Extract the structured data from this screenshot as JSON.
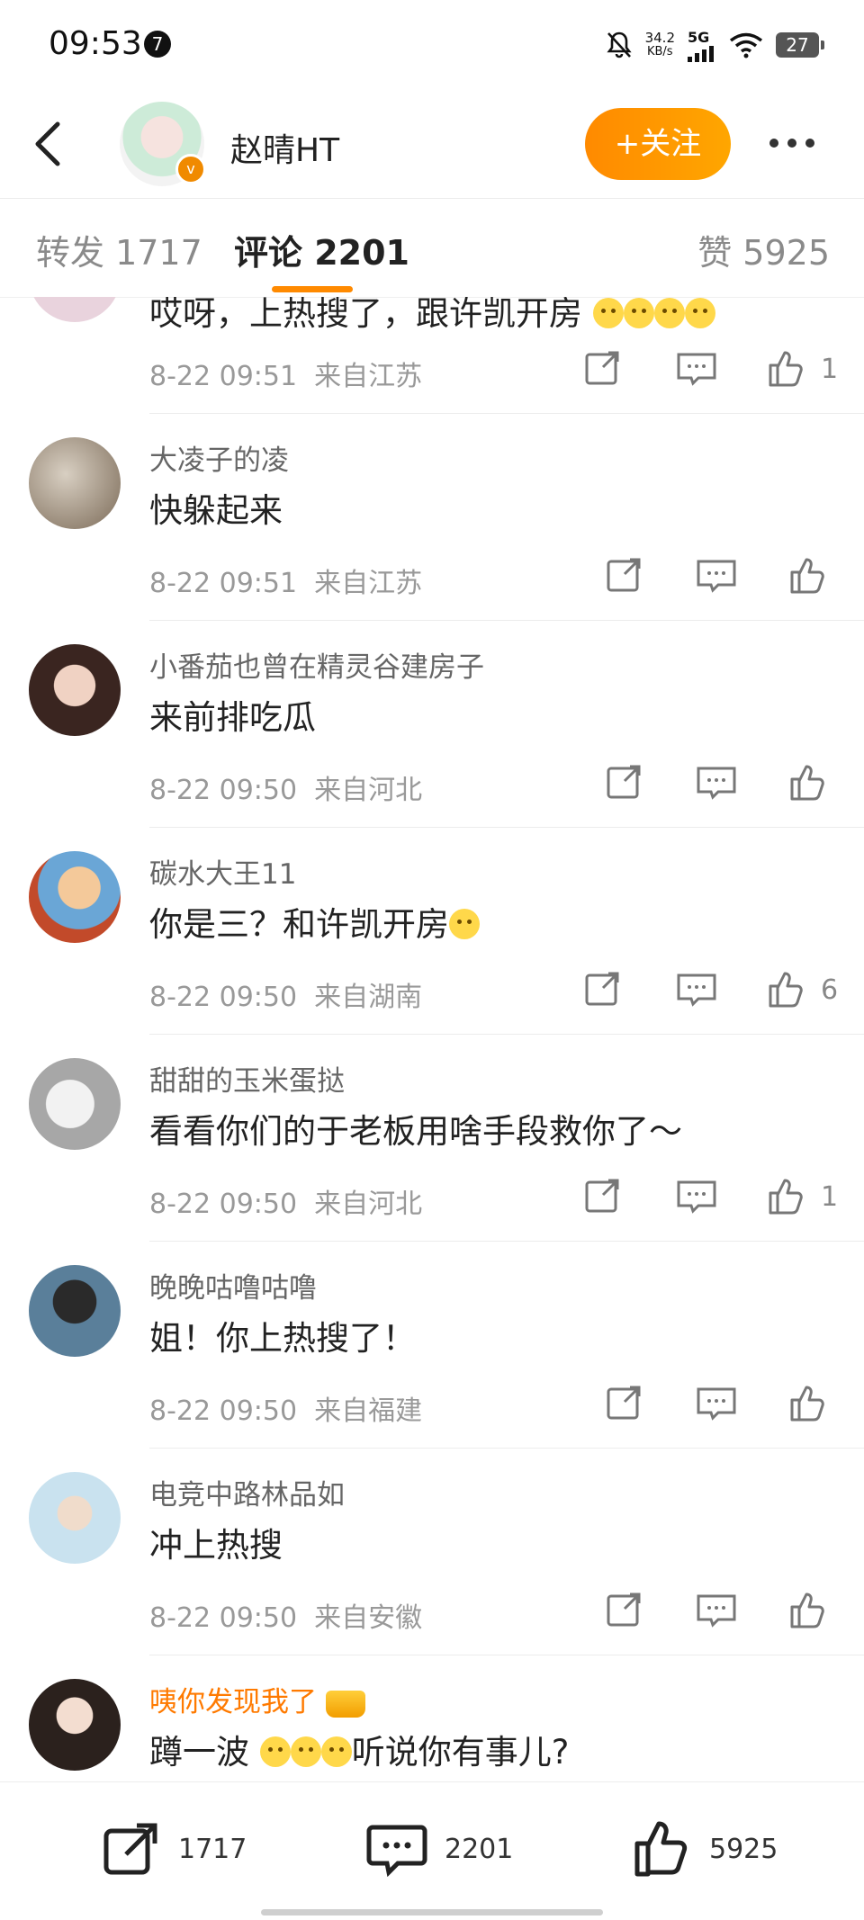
{
  "status_bar": {
    "time": "09:53",
    "notification_count": "7",
    "net_speed_value": "34.2",
    "net_speed_unit": "KB/s",
    "signal_label": "5G",
    "battery": "27"
  },
  "header": {
    "name": "赵晴HT",
    "follow_label": "+关注"
  },
  "tabs": {
    "repost": "转发 1717",
    "comments": "评论 2201",
    "likes": "赞 5925"
  },
  "comments": [
    {
      "name": "",
      "text": "哎呀，上热搜了，跟许凯开房",
      "time": "8-22 09:51",
      "location": "来自江苏",
      "likes": "1"
    },
    {
      "name": "大凌子的凌",
      "text": "快躲起来",
      "time": "8-22 09:51",
      "location": "来自江苏",
      "likes": ""
    },
    {
      "name": "小番茄也曾在精灵谷建房子",
      "text": "来前排吃瓜",
      "time": "8-22 09:50",
      "location": "来自河北",
      "likes": ""
    },
    {
      "name": "碳水大王11",
      "text": "你是三？和许凯开房",
      "time": "8-22 09:50",
      "location": "来自湖南",
      "likes": "6"
    },
    {
      "name": "甜甜的玉米蛋挞",
      "text": "看看你们的于老板用啥手段救你了～",
      "time": "8-22 09:50",
      "location": "来自河北",
      "likes": "1"
    },
    {
      "name": "晚晚咕噜咕噜",
      "text": "姐！你上热搜了！",
      "time": "8-22 09:50",
      "location": "来自福建",
      "likes": ""
    },
    {
      "name": "电竞中路林品如",
      "text": "冲上热搜",
      "time": "8-22 09:50",
      "location": "来自安徽",
      "likes": ""
    },
    {
      "name": "咦你发现我了",
      "text_before": "蹲一波",
      "text_after": "听说你有事儿?",
      "time": "",
      "location": "",
      "likes": ""
    }
  ],
  "bottom_bar": {
    "repost_count": "1717",
    "comment_count": "2201",
    "like_count": "5925"
  },
  "colors": {
    "accent": "#ff8a00",
    "vip_name": "#ff7a00"
  },
  "icons": [
    "back-arrow-icon",
    "more-icon",
    "share-icon",
    "comment-icon",
    "like-icon"
  ]
}
